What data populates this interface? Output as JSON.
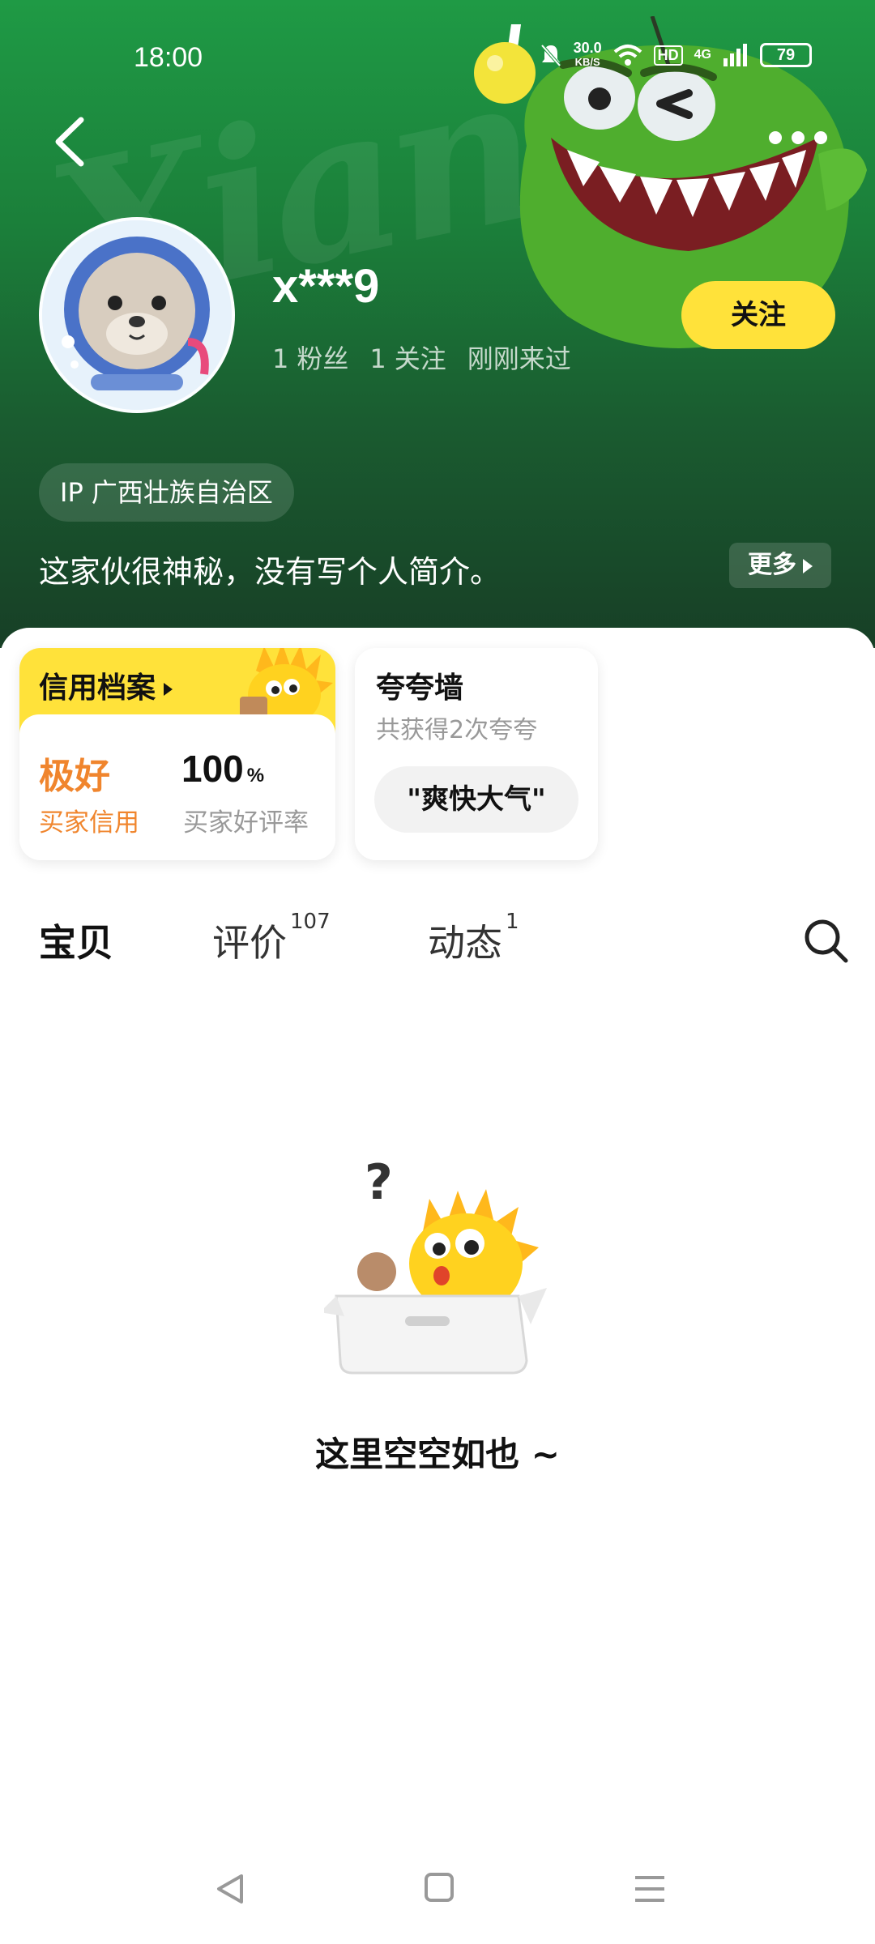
{
  "status_bar": {
    "time": "18:00",
    "network_speed": "30.0",
    "network_unit": "KB/S",
    "hd": "HD",
    "signal_gen": "4G",
    "battery": "79"
  },
  "header": {
    "watermark": "Xianyu"
  },
  "profile": {
    "username": "x***9",
    "fans_count": "1",
    "fans_label": "粉丝",
    "follow_count": "1",
    "follow_label": "关注",
    "last_seen": "刚刚来过",
    "follow_button": "关注",
    "ip_location": "IP 广西壮族自治区",
    "bio": "这家伙很神秘，没有写个人简介。",
    "more_label": "更多"
  },
  "credit": {
    "title": "信用档案",
    "buyer_credit_value": "极好",
    "buyer_credit_label": "买家信用",
    "good_rate_value": "100",
    "good_rate_unit": "%",
    "good_rate_label": "买家好评率"
  },
  "praise_wall": {
    "title": "夸夸墙",
    "subtitle": "共获得2次夸夸",
    "tag": "\"爽快大气\""
  },
  "tabs": [
    {
      "label": "宝贝",
      "count": ""
    },
    {
      "label": "评价",
      "count": "107"
    },
    {
      "label": "动态",
      "count": "1"
    }
  ],
  "empty_state": {
    "message": "这里空空如也 ~"
  },
  "colors": {
    "accent_yellow": "#ffe23a",
    "credit_orange": "#f0852d",
    "header_green": "#1b7f3a"
  },
  "icons": [
    "back-arrow-icon",
    "more-dots-icon",
    "search-icon",
    "nav-back-icon",
    "nav-home-icon",
    "nav-menu-icon"
  ]
}
